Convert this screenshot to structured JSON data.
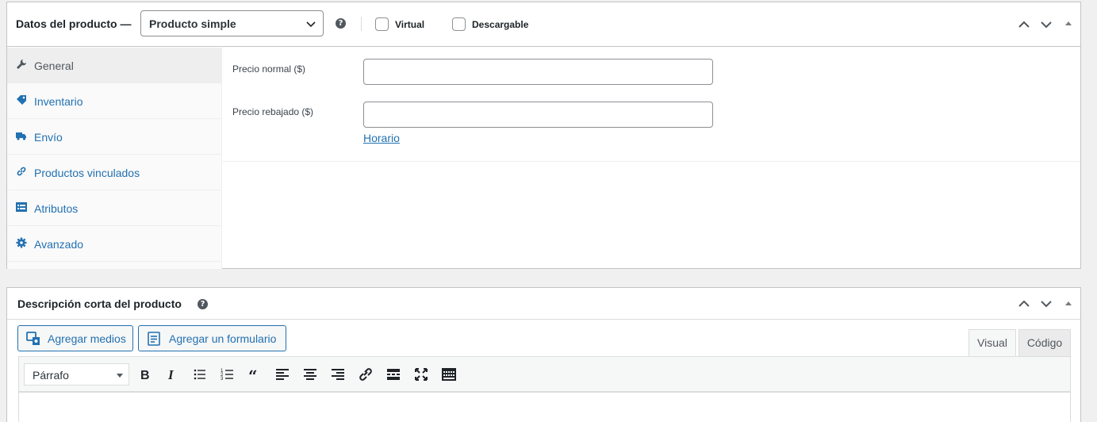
{
  "product_data": {
    "title": "Datos del producto —",
    "type_select": "Producto simple",
    "virtual_label": "Virtual",
    "downloadable_label": "Descargable",
    "tabs": [
      {
        "label": "General",
        "icon": "wrench-icon",
        "active": true
      },
      {
        "label": "Inventario",
        "icon": "tag-icon"
      },
      {
        "label": "Envío",
        "icon": "truck-icon"
      },
      {
        "label": "Productos vinculados",
        "icon": "link-icon"
      },
      {
        "label": "Atributos",
        "icon": "list-icon"
      },
      {
        "label": "Avanzado",
        "icon": "gear-icon"
      }
    ],
    "general": {
      "regular_price_label": "Precio normal ($)",
      "regular_price_value": "",
      "sale_price_label": "Precio rebajado ($)",
      "sale_price_value": "",
      "schedule_link": "Horario"
    }
  },
  "short_description": {
    "title": "Descripción corta del producto",
    "add_media": "Agregar medios",
    "add_form": "Agregar un formulario",
    "tab_visual": "Visual",
    "tab_code": "Código",
    "format_select": "Párrafo",
    "toolbar_icons": [
      "bold-icon",
      "italic-icon",
      "bullet-list-icon",
      "numbered-list-icon",
      "blockquote-icon",
      "align-left-icon",
      "align-center-icon",
      "align-right-icon",
      "insert-link-icon",
      "read-more-icon",
      "fullscreen-icon",
      "toolbar-toggle-icon"
    ]
  },
  "colors": {
    "accent": "#2271b1",
    "border": "#c3c4c7",
    "background": "#f0f0f1"
  }
}
